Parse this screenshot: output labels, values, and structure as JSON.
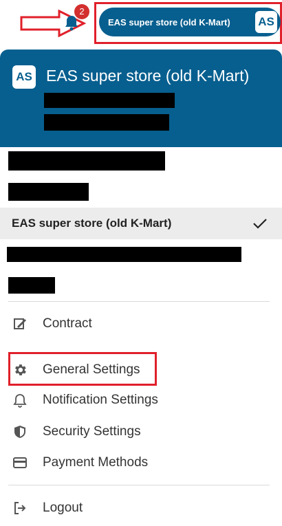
{
  "topbar": {
    "notification_count": "2",
    "account_button_label": "EAS super store (old K-Mart)",
    "account_initials": "AS"
  },
  "panel": {
    "header": {
      "initials": "AS",
      "store_name": "EAS super store (old K-Mart)"
    },
    "selected_store": "EAS super store (old K-Mart)",
    "menu": [
      {
        "label": "Contract",
        "icon": "contract-icon"
      },
      {
        "label": "General Settings",
        "icon": "gear-icon"
      },
      {
        "label": "Notification Settings",
        "icon": "bell-icon"
      },
      {
        "label": "Security Settings",
        "icon": "shield-icon"
      },
      {
        "label": "Payment Methods",
        "icon": "credit-card-icon"
      },
      {
        "label": "Logout",
        "icon": "logout-icon"
      }
    ]
  },
  "colors": {
    "brand": "#075f8f",
    "highlight": "#e0202a",
    "badge": "#d32f2f"
  }
}
